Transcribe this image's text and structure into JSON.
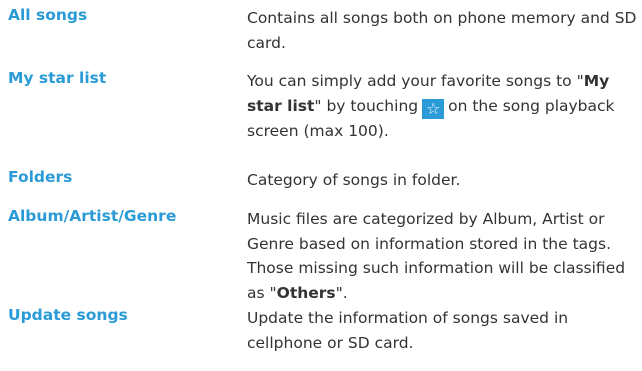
{
  "entries": [
    {
      "term": "All songs",
      "desc": "Contains all songs both on phone memory and SD card."
    },
    {
      "term": "My star list",
      "desc_pre": "You can simply add your favorite songs to \"",
      "desc_bold": "My star list",
      "desc_mid": "\" by touching",
      "desc_post": "on the song playback screen (max 100).",
      "icon": "star-icon"
    },
    {
      "term": "Folders",
      "desc": "Category of songs in folder."
    },
    {
      "term": "Album/Artist/Genre",
      "desc_pre": "Music files are categorized by Album, Artist or Genre based on information stored in the tags. Those missing such information will be classified as \"",
      "desc_bold": "Others",
      "desc_post": "\"."
    },
    {
      "term": "Update songs",
      "desc": "Update the information of songs saved in cellphone or SD card."
    }
  ],
  "colors": {
    "term": "#2a9bd6",
    "text": "#333333",
    "icon_bg": "#2a9bd6"
  }
}
